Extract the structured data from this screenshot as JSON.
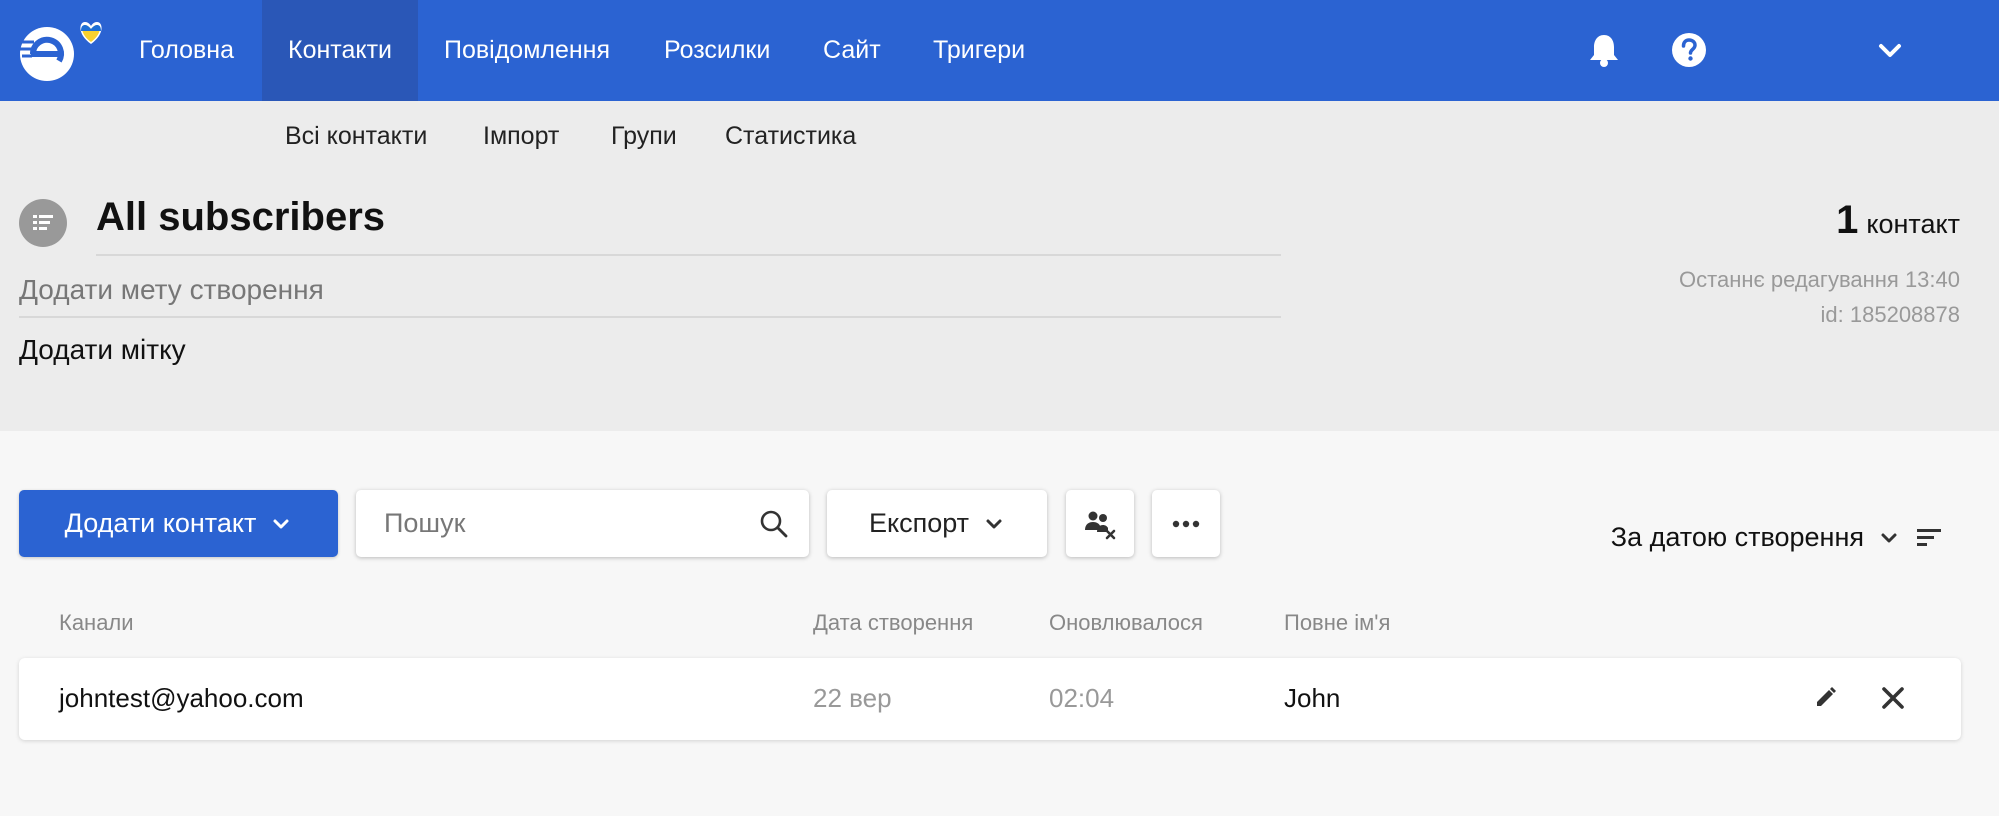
{
  "nav": {
    "items": [
      {
        "label": "Головна",
        "active": false
      },
      {
        "label": "Контакти",
        "active": true
      },
      {
        "label": "Повідомлення",
        "active": false
      },
      {
        "label": "Розсилки",
        "active": false
      },
      {
        "label": "Сайт",
        "active": false
      },
      {
        "label": "Тригери",
        "active": false
      }
    ],
    "icons": [
      "bell-icon",
      "help-icon",
      "chevron-down-icon"
    ]
  },
  "subnav": {
    "items": [
      {
        "label": "Всі контакти"
      },
      {
        "label": "Імпорт"
      },
      {
        "label": "Групи"
      },
      {
        "label": "Статистика"
      }
    ]
  },
  "header": {
    "title": "All subscribers",
    "goal_placeholder": "Додати мету створення",
    "tag_label": "Додати мітку",
    "count": "1",
    "count_word": "контакт",
    "last_edit": "Останнє редагування 13:40",
    "id_label": "id:  185208878"
  },
  "toolbar": {
    "add_contact_label": "Додати контакт",
    "search_placeholder": "Пошук",
    "export_label": "Експорт",
    "sort_label": "За датою створення"
  },
  "table": {
    "columns": [
      "Канали",
      "Дата створення",
      "Оновлювалося",
      "Повне ім'я"
    ],
    "rows": [
      {
        "channel": "johntest@yahoo.com",
        "created": "22 вер",
        "updated": "02:04",
        "name": "John"
      }
    ]
  },
  "colors": {
    "brand_blue": "#2b63d2",
    "nav_active": "#2a57b7",
    "header_bg": "#ececec",
    "page_bg": "#f7f7f7",
    "flag_blue": "#1e6fd6",
    "flag_yellow": "#f8d12f"
  }
}
